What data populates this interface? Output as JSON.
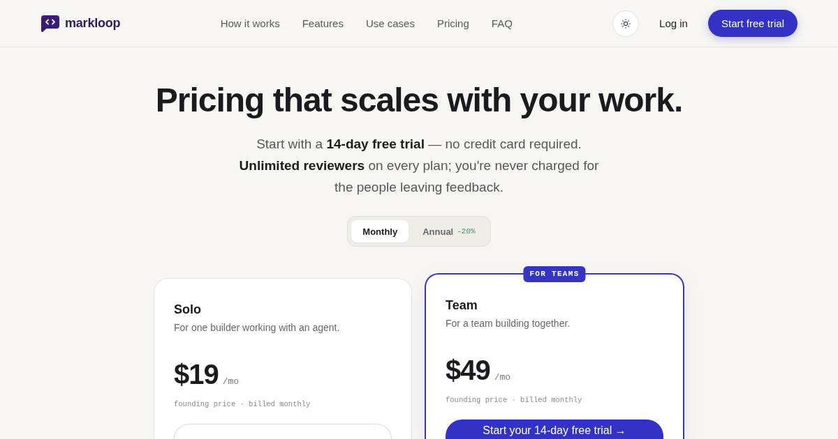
{
  "header": {
    "logo": "markloop",
    "nav": [
      "How it works",
      "Features",
      "Use cases",
      "Pricing",
      "FAQ"
    ],
    "login": "Log in",
    "cta": "Start free trial"
  },
  "hero": {
    "title": "Pricing that scales with your work.",
    "subtitle": "Start with a **14-day free trial** — no credit card required. **Unlimited reviewers** on every plan; you're never charged for the people leaving feedback."
  },
  "billing_toggle": {
    "options": [
      {
        "label": "Monthly",
        "selected": true
      },
      {
        "label": "Annual",
        "selected": false,
        "discount": "-20%"
      }
    ]
  },
  "plans": [
    {
      "name": "Solo",
      "description": "For one builder working with an agent.",
      "price": "$19",
      "period": "/mo",
      "note": "founding price · billed monthly",
      "featured": false,
      "button": {
        "kind": "outline"
      }
    },
    {
      "name": "Team",
      "description": "For a team building together.",
      "badge": "FOR TEAMS",
      "price": "$49",
      "period": "/mo",
      "note": "founding price · billed monthly",
      "featured": true,
      "button": {
        "kind": "primary",
        "label": "Start your 14-day free trial →"
      }
    }
  ]
}
